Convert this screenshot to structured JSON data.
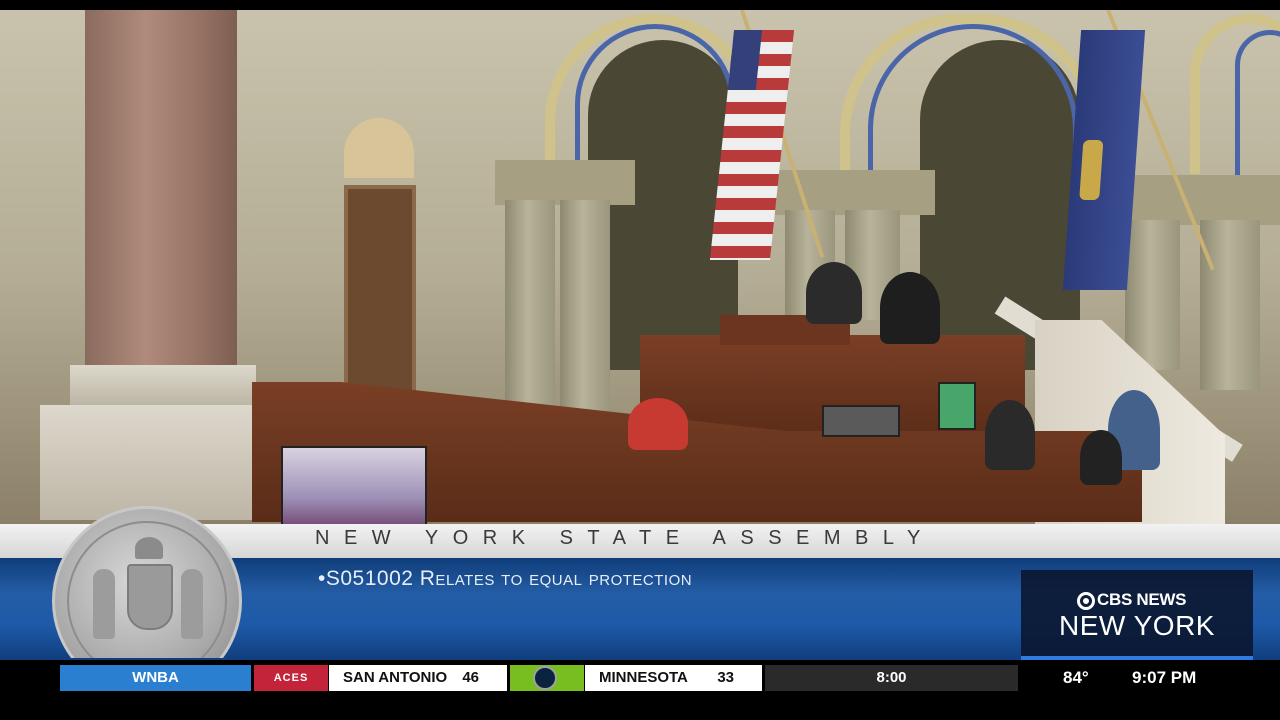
{
  "broadcast": {
    "chamber_title": "NEW YORK STATE ASSEMBLY",
    "bill_caption": "•S051002 Relates to equal protection"
  },
  "channel_logo": {
    "network": "CBS NEWS",
    "city": "NEW YORK",
    "icon": "cbs-eye-icon"
  },
  "ticker": {
    "league": "WNBA",
    "team1_logo_text": "ACES",
    "team1": "SAN ANTONIO",
    "team1_score": "46",
    "team2": "MINNESOTA",
    "team2_score": "33",
    "game_clock": "8:00",
    "temperature": "84°",
    "time": "9:07 PM"
  },
  "colors": {
    "lower_third_blue": "#1e5aa8",
    "league_blue": "#2a7fd0",
    "aces_red": "#c4243a",
    "lynx_green": "#78be20"
  }
}
